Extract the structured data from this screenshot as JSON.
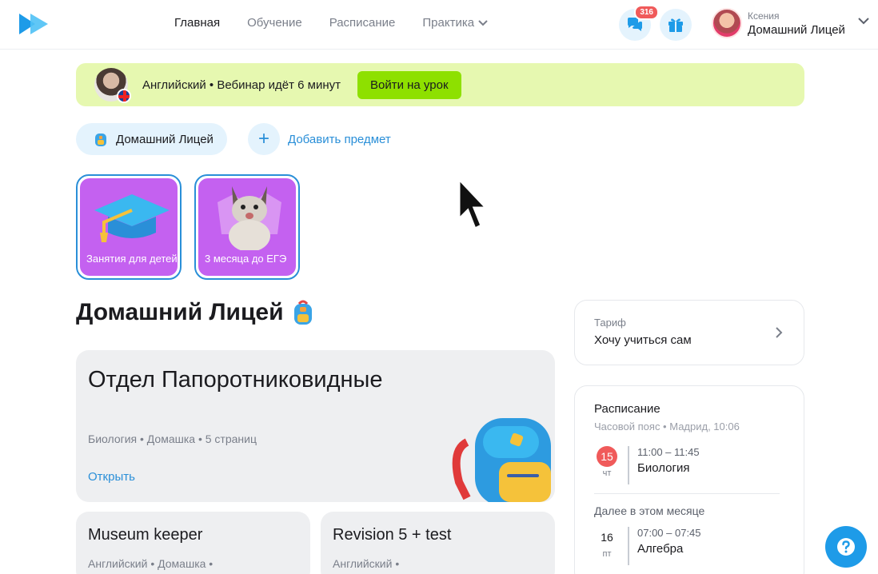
{
  "header": {
    "nav": [
      {
        "label": "Главная",
        "active": true
      },
      {
        "label": "Обучение",
        "active": false
      },
      {
        "label": "Расписание",
        "active": false
      },
      {
        "label": "Практика",
        "active": false
      }
    ],
    "chat_badge": "316",
    "user": {
      "name": "Ксения",
      "school": "Домашний Лицей"
    }
  },
  "banner": {
    "text": "Английский • Вебинар идёт 6 минут",
    "button": "Войти на урок"
  },
  "subjects": {
    "chip": "Домашний Лицей",
    "add": "Добавить предмет"
  },
  "stories": [
    {
      "label": "Занятия для детей"
    },
    {
      "label": "3 месяца до ЕГЭ"
    }
  ],
  "section": {
    "title": "Домашний Лицей"
  },
  "main_card": {
    "title": "Отдел Папоротниковидные",
    "meta": "Биология • Домашка • 5 страниц",
    "link": "Открыть"
  },
  "small_cards": [
    {
      "title": "Museum keeper",
      "meta": "Английский • Домашка •"
    },
    {
      "title": "Revision 5 + test",
      "meta": "Английский •"
    }
  ],
  "tariff": {
    "label": "Тариф",
    "value": "Хочу учиться сам"
  },
  "schedule": {
    "title": "Расписание",
    "timezone": "Часовой пояс • Мадрид, 10:06",
    "later_label": "Далее в этом месяце",
    "items": [
      {
        "day": "15",
        "weekday": "чт",
        "time": "11:00 – 11:45",
        "subject": "Биология",
        "today": true
      },
      {
        "day": "16",
        "weekday": "пт",
        "time": "07:00 – 07:45",
        "subject": "Алгебра",
        "today": false
      }
    ]
  },
  "colors": {
    "accent": "#2a8fd8",
    "banner": "#e6f8b0",
    "join": "#8ee000",
    "story": "#c461f0",
    "badge": "#f05a5a"
  }
}
